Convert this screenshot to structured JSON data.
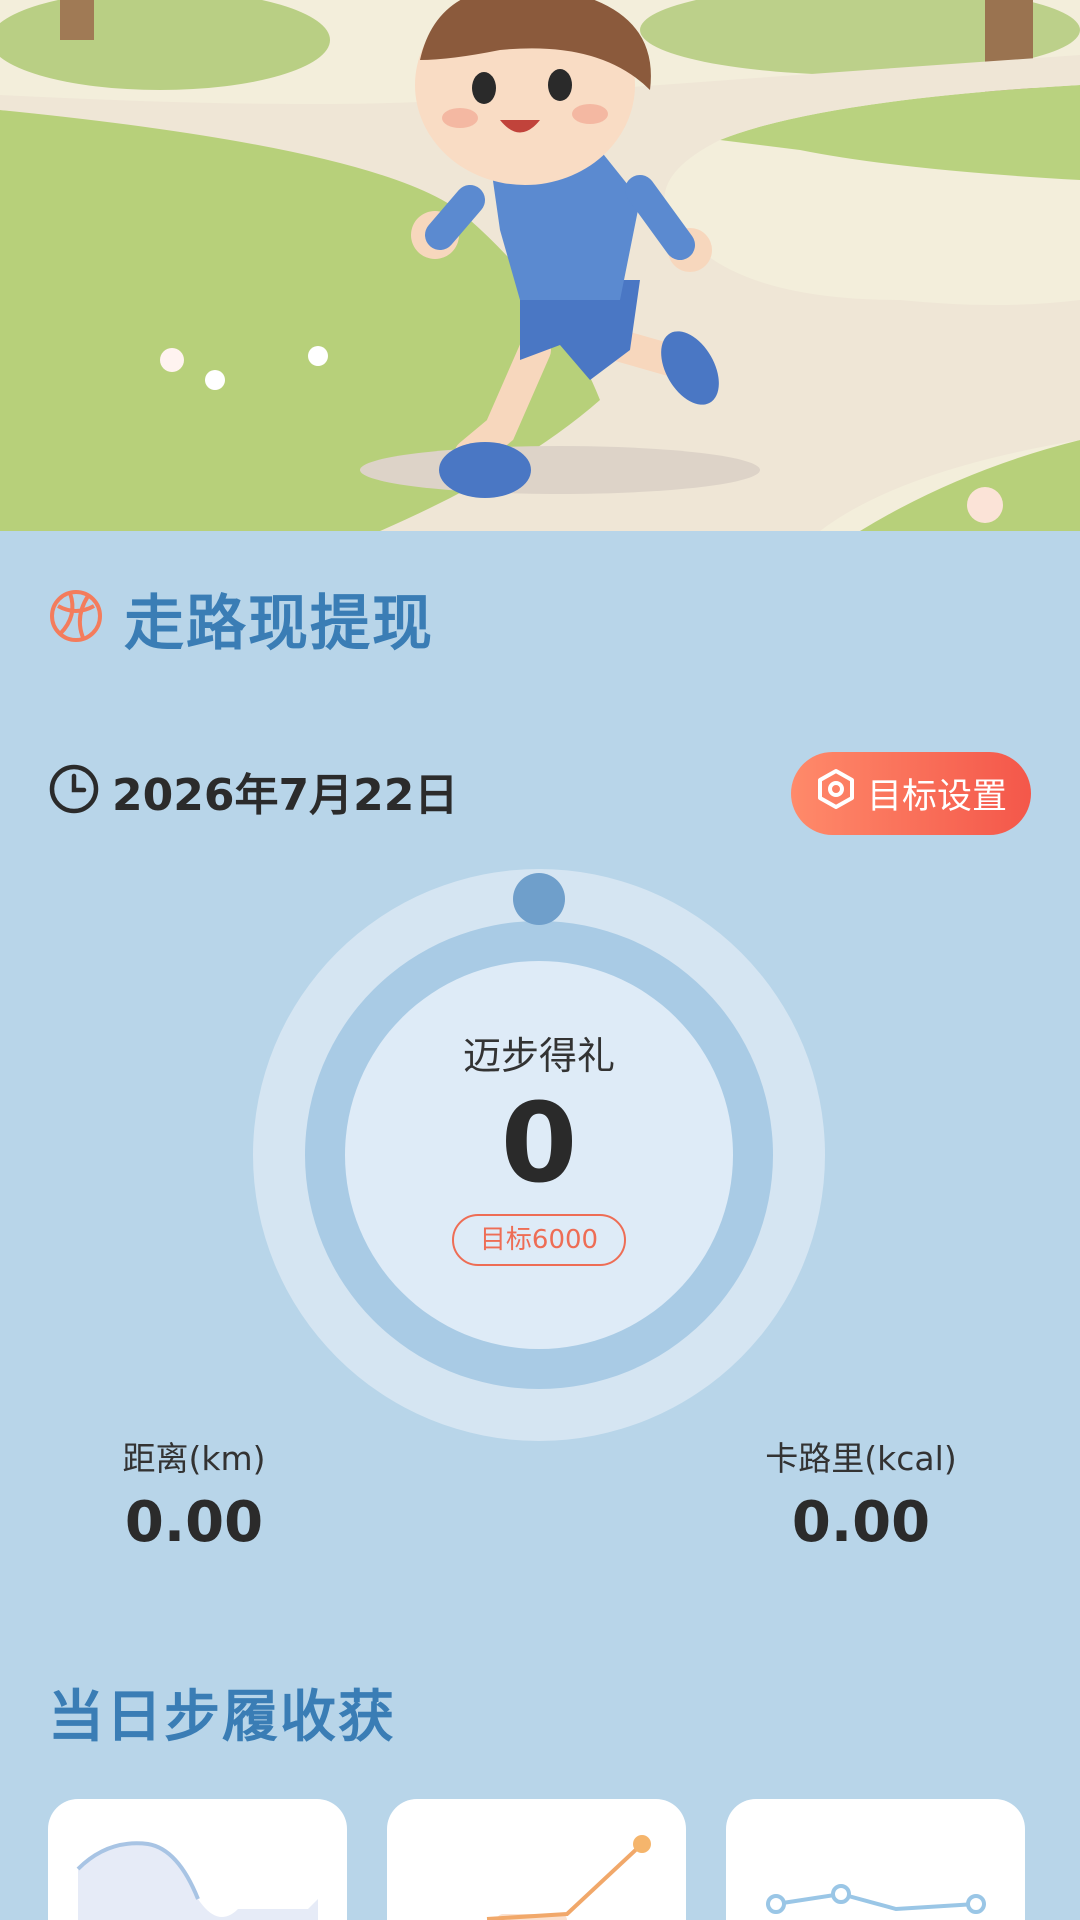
{
  "header": {
    "title": "走路现提现"
  },
  "date_bar": {
    "date": "2026年7月22日",
    "goal_button_label": "目标设置"
  },
  "progress_ring": {
    "label": "迈步得礼",
    "steps": "0",
    "goal_label": "目标6000",
    "progress_fraction": 0
  },
  "stats": {
    "distance_label": "距离(km)",
    "distance_value": "0.00",
    "calorie_label": "卡路里(kcal)",
    "calorie_value": "0.00"
  },
  "section": {
    "title": "当日步履收获"
  },
  "icons": {
    "title_icon": "basketball-icon",
    "date_icon": "clock-icon",
    "goal_icon": "hexagon-settings-icon"
  },
  "colors": {
    "background": "#b8d5e9",
    "accent_blue": "#3a7db5",
    "accent_orange": "#f4574a"
  }
}
